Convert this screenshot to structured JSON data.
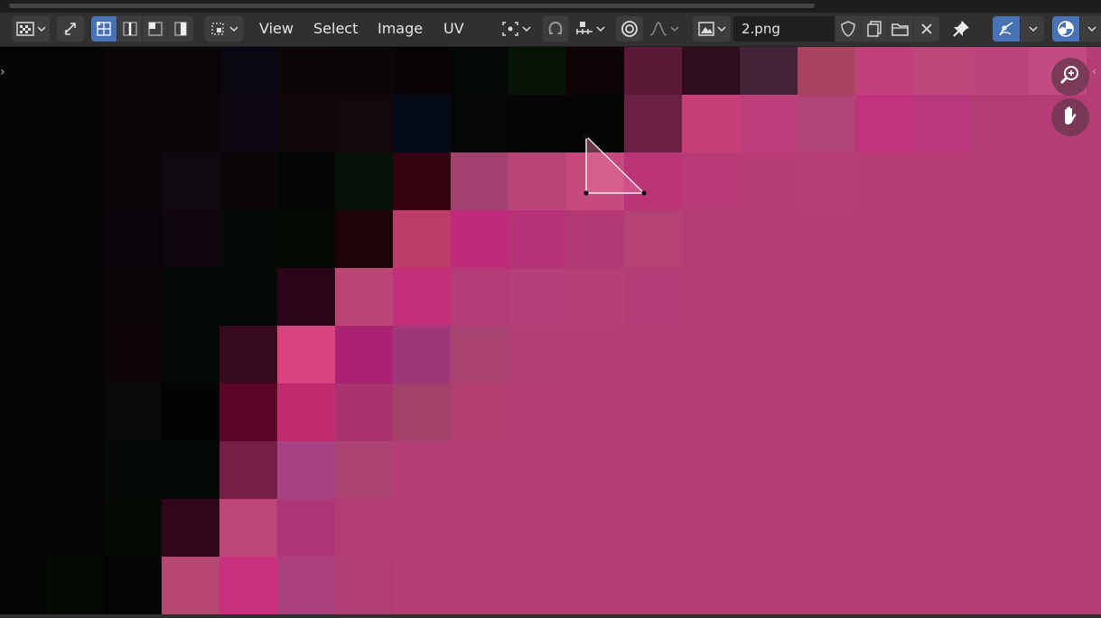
{
  "topbar": {
    "menus": {
      "view": "View",
      "select": "Select",
      "image": "Image",
      "uv": "UV"
    },
    "image_name": "2.png"
  },
  "icons": [
    "editor-type-icon",
    "sync-selection-icon",
    "vertex-select-icon",
    "edge-select-icon",
    "face-select-icon",
    "island-select-icon",
    "sticky-select-mode-icon",
    "pivot-point-icon",
    "snap-icon",
    "snap-increment-icon",
    "proportional-editing-icon",
    "falloff-curve-icon",
    "image-browse-icon",
    "fake-user-shield-icon",
    "new-image-icon",
    "open-image-icon",
    "unlink-icon",
    "pin-icon",
    "gizmo-icon",
    "overlay-icon",
    "zoom-icon",
    "pan-hand-icon"
  ],
  "colors": {
    "header_bg": "#303030",
    "accent_blue": "#4772b3",
    "image_base": "#b43d74"
  },
  "tile_size": 64,
  "tiles": [
    [
      "#050305",
      "#070405",
      "#0a0508",
      "#0a0508",
      "#0b0710",
      "#0c0609",
      "#0b0608",
      "#080406",
      "#030805",
      "#061407",
      "#100306",
      "#5a1a35",
      "#300d1c",
      "#432336",
      "#a7435f",
      "#c2407a",
      "#bc457a",
      "#bc437b",
      "#c24a81"
    ],
    [
      "#040305",
      "#070405",
      "#0b0607",
      "#0b0609",
      "#0c0710",
      "#0f0709",
      "#13070b",
      "#040b16",
      "#050706",
      "#050507",
      "#030404",
      "#6b2242",
      "#c63f78",
      "#bc3f7b",
      "#b24377",
      "#c0337a",
      "#b8367a",
      "#b23d73",
      "#b63c76"
    ],
    [
      "#050305",
      "#070405",
      "#0a0507",
      "#100810",
      "#0c0608",
      "#040604",
      "#061208",
      "#34030f",
      "#a34271",
      "#b94478",
      "#c64a7d",
      "#bb3478",
      "#b73b76",
      "#b53c74",
      "#b63e75",
      "#b53d76",
      "#b53d74",
      "#b43c74",
      "#b43c74"
    ],
    [
      "#050305",
      "#070405",
      "#0a050a",
      "#0e060c",
      "#050a06",
      "#040b05",
      "#1c0306",
      "#be3c6a",
      "#c02a7c",
      "#b53376",
      "#b13873",
      "#b24374",
      "#b33d74",
      "#b33e75",
      "#b43d74",
      "#b43d74",
      "#b33d74",
      "#b43c74",
      "#b43c74"
    ],
    [
      "#040305",
      "#070405",
      "#0a0508",
      "#040806",
      "#040905",
      "#2b0518",
      "#bb4575",
      "#c22f78",
      "#b53b78",
      "#b34078",
      "#b63f78",
      "#b43b75",
      "#b43d74",
      "#b43d74",
      "#b43d74",
      "#b43d74",
      "#b43d74",
      "#b43c74",
      "#b43c74"
    ],
    [
      "#040305",
      "#070405",
      "#0d0508",
      "#040a05",
      "#380a1e",
      "#d9447e",
      "#ac2272",
      "#9e367a",
      "#a84371",
      "#b13f73",
      "#b43d73",
      "#b43d74",
      "#b43d74",
      "#b43d74",
      "#b43d74",
      "#b43d74",
      "#b43d74",
      "#b43c74",
      "#b43c74"
    ],
    [
      "#040305",
      "#070405",
      "#080a07",
      "#040304",
      "#5a0627",
      "#c12b6b",
      "#a9326f",
      "#a44169",
      "#b23d6f",
      "#b43d73",
      "#b43d74",
      "#b43d74",
      "#b43d74",
      "#b43d74",
      "#b43d74",
      "#b43d74",
      "#b43d74",
      "#b43c74",
      "#b43c74"
    ],
    [
      "#040305",
      "#070405",
      "#040a05",
      "#040a05",
      "#751e48",
      "#a64284",
      "#ab4472",
      "#b33e74",
      "#b43d74",
      "#b43d74",
      "#b43d74",
      "#b43d74",
      "#b43d74",
      "#b43d74",
      "#b43d74",
      "#b43d74",
      "#b43d74",
      "#b43c74",
      "#b43c74"
    ],
    [
      "#040305",
      "#070405",
      "#040904",
      "#2f0718",
      "#be4677",
      "#ad3676",
      "#b23d74",
      "#b43d74",
      "#b43d74",
      "#b43d74",
      "#b43d74",
      "#b43d74",
      "#b43d74",
      "#b43d74",
      "#b43d74",
      "#b43d74",
      "#b43d74",
      "#b43c74",
      "#b43c74"
    ],
    [
      "#040305",
      "#060a05",
      "#040405",
      "#b64773",
      "#c9317e",
      "#a9407c",
      "#b03c74",
      "#b43d74",
      "#b43d74",
      "#b43d74",
      "#b43d74",
      "#b43d74",
      "#b43d74",
      "#b43d74",
      "#b43d74",
      "#b43d74",
      "#b43d74",
      "#b43c74",
      "#b43c74"
    ]
  ]
}
